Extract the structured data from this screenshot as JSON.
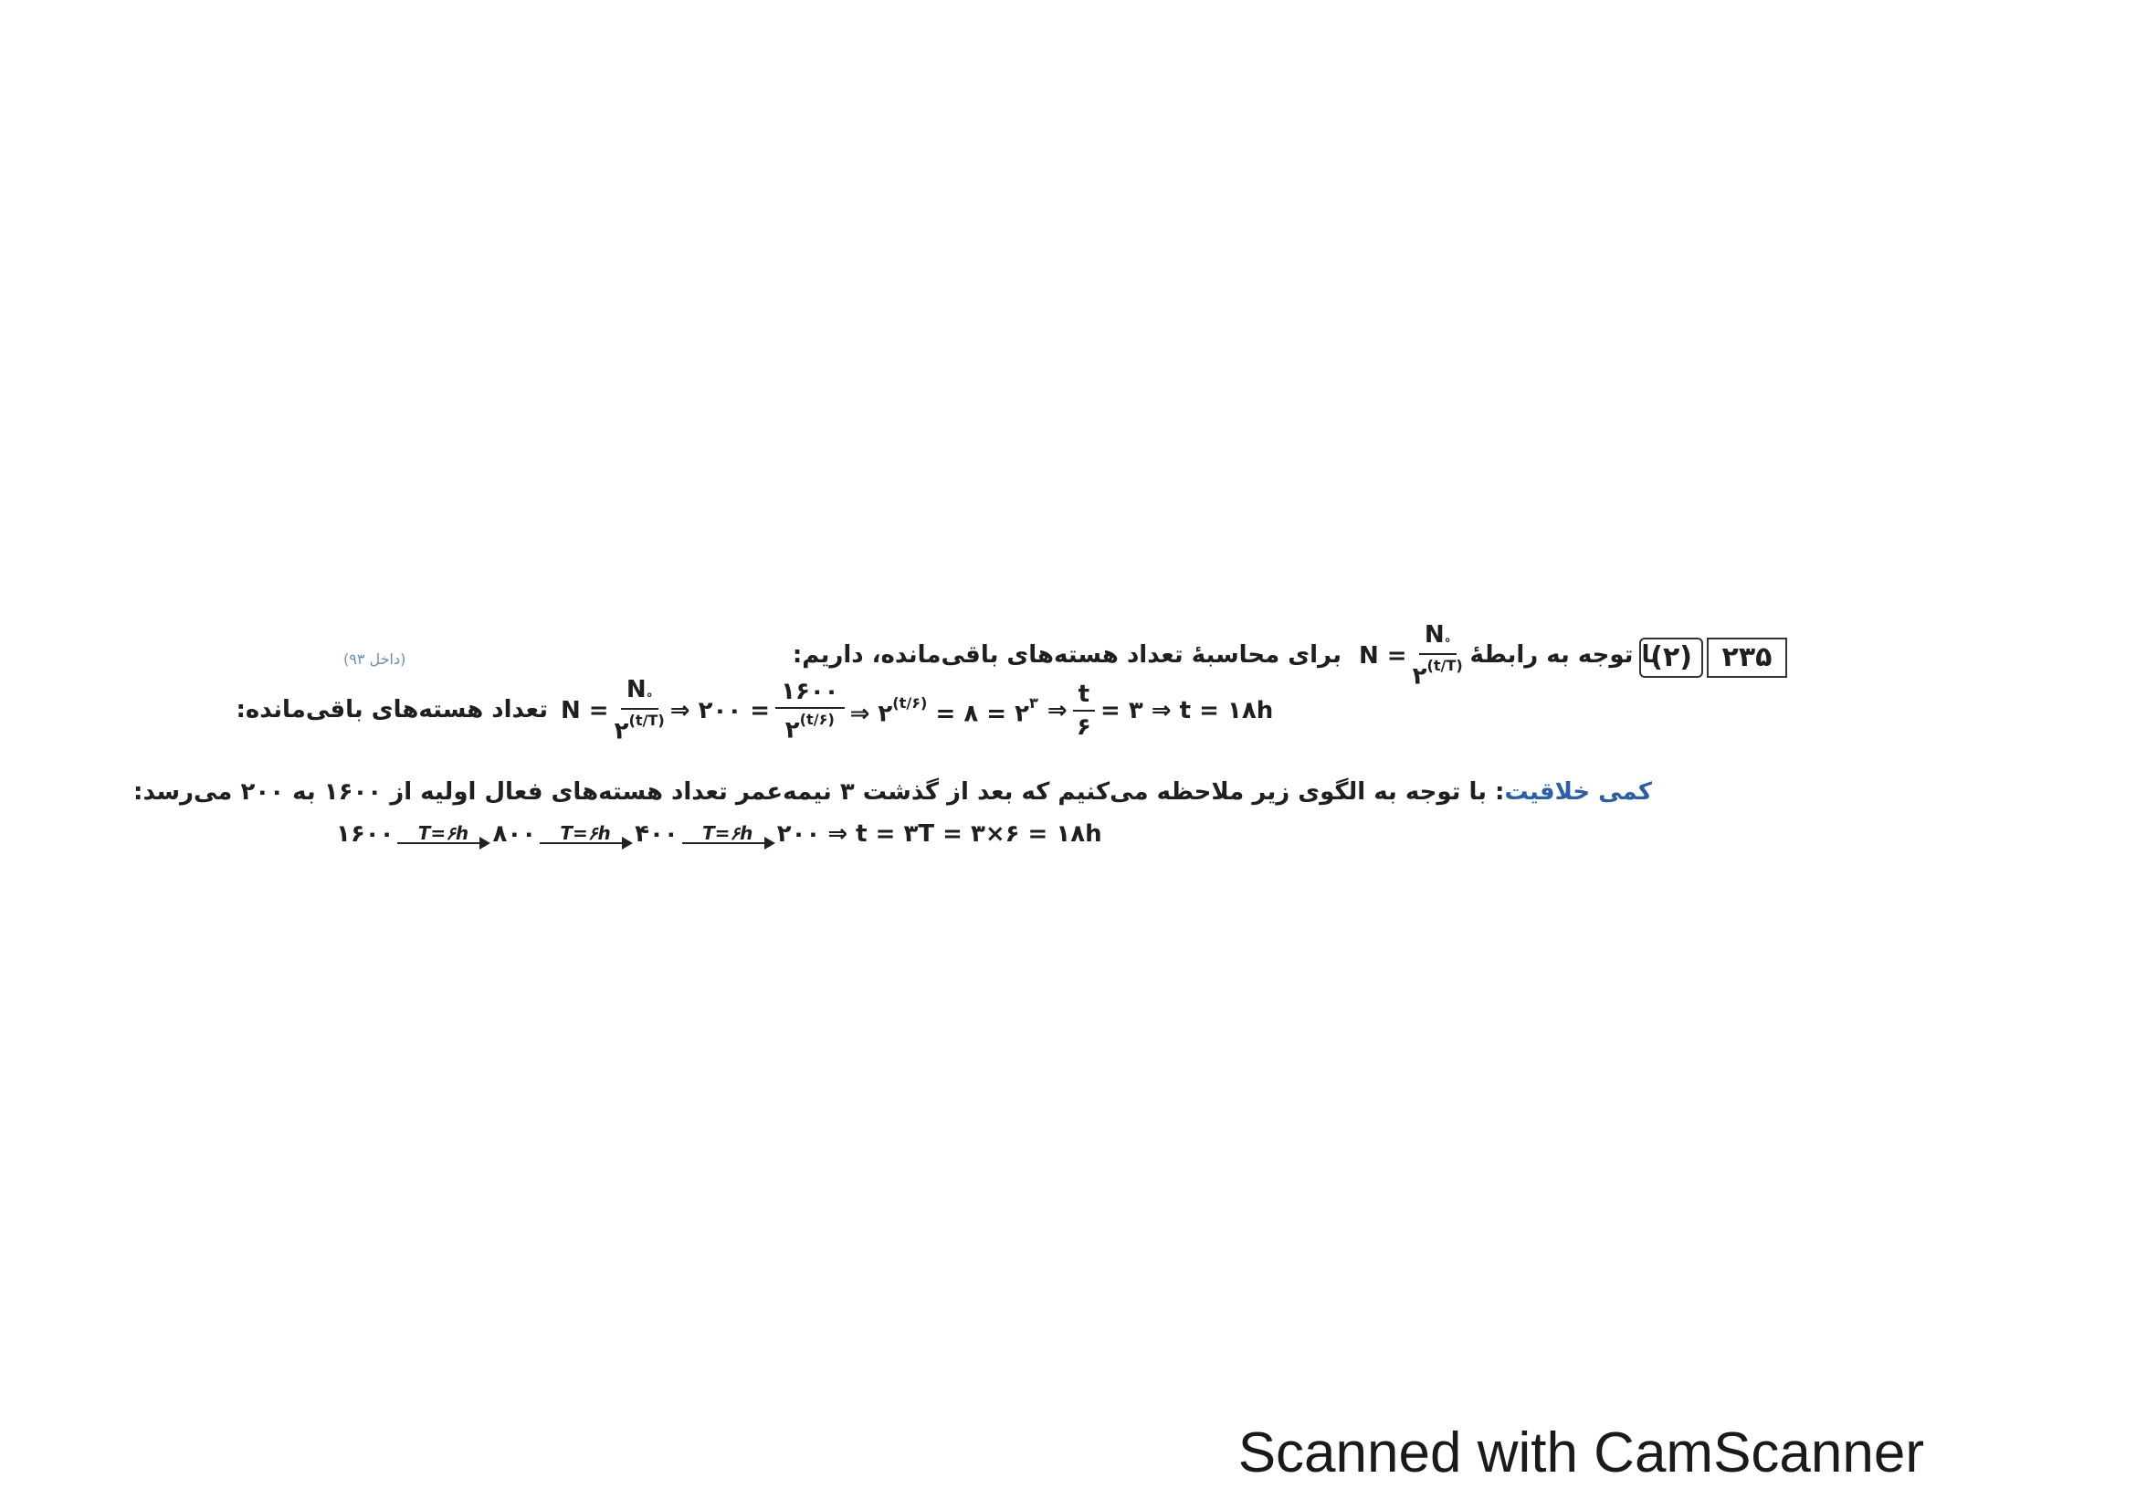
{
  "question": {
    "number": "۲۳۵",
    "answer": "(۲)",
    "source": "(داخل ۹۳)",
    "intro_before": "با توجه به رابطهٔ",
    "intro_after": "برای محاسبهٔ تعداد هسته‌های باقی‌مانده، داریم:"
  },
  "formula": {
    "lhs": "N =",
    "numerator": "N",
    "denominator": "۲",
    "exponent": "(t/T)"
  },
  "solution_line": {
    "label": "تعداد هسته‌های باقی‌مانده:",
    "n_eq": "N =",
    "numerator": "N",
    "denominator": "۲",
    "exponent": "(t/T)",
    "step1_lhs": "⇒ ۲۰۰ =",
    "step1_num": "۱۶۰۰",
    "step1_den": "۲",
    "step1_exp": "(t/۶)",
    "step2": "⇒ ۲",
    "step2_exp": "(t/۶)",
    "step2_rest": "= ۸ = ۲",
    "step2_pow": "۳",
    "step3": "⇒",
    "step3_num": "t",
    "step3_den": "۶",
    "step3_rest": "= ۳ ⇒ t = ۱۸h"
  },
  "creativity": {
    "label": "کمی خلاقیت",
    "text": ": با توجه به الگوی زیر ملاحظه می‌کنیم که بعد از گذشت ۳ نیمه‌عمر تعداد هسته‌های فعال اولیه از ۱۶۰۰ به ۲۰۰ می‌رسد:"
  },
  "chain": {
    "values": [
      "۱۶۰۰",
      "۸۰۰",
      "۴۰۰",
      "۲۰۰"
    ],
    "arrow_label": "T=۶h",
    "result": "⇒ t = ۳T = ۳×۶ = ۱۸h"
  },
  "footer": "Scanned with CamScanner"
}
